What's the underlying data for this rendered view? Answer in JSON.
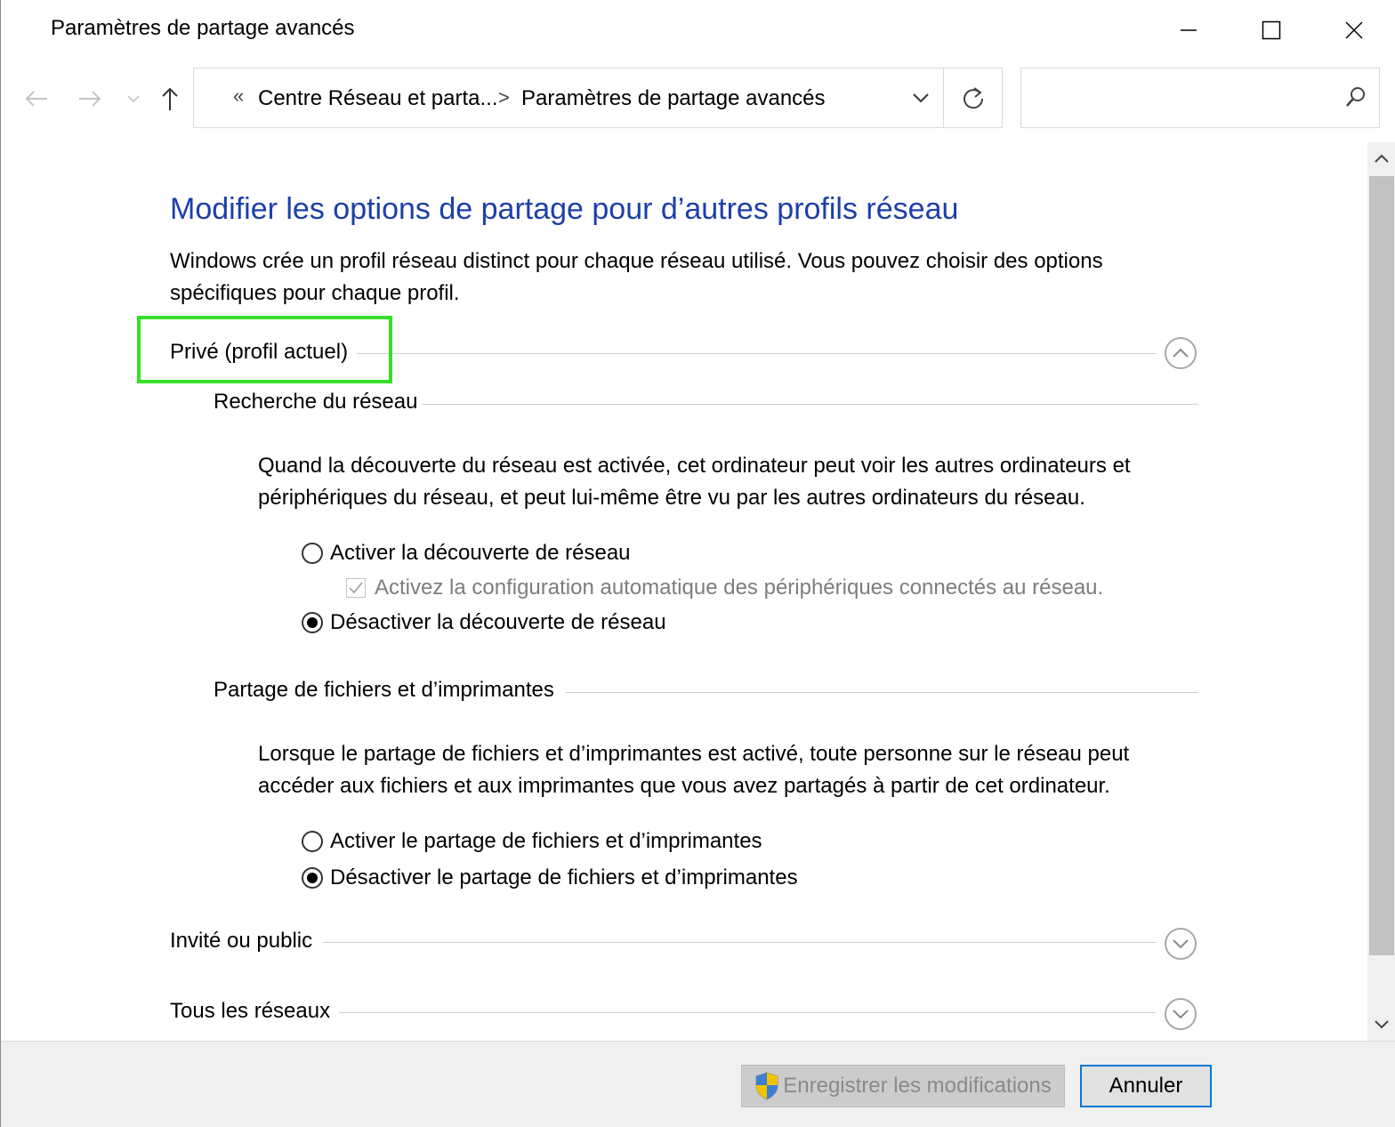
{
  "window": {
    "title": "Paramètres de partage avancés",
    "controls": {
      "minimize": "minimize-icon",
      "maximize": "maximize-icon",
      "close": "close-icon"
    }
  },
  "nav": {
    "back": "arrow-left-icon",
    "forward": "arrow-right-icon",
    "recent": "chevron-down-icon",
    "up": "arrow-up-icon",
    "breadcrumb": {
      "overflow": "«",
      "items": [
        "Centre Réseau et parta...",
        "Paramètres de partage avancés"
      ],
      "separator": ">"
    },
    "search_placeholder": ""
  },
  "main": {
    "title": "Modifier les options de partage pour d’autres profils réseau",
    "description": "Windows crée un profil réseau distinct pour chaque réseau utilisé. Vous pouvez choisir des options spécifiques pour chaque profil.",
    "profiles": [
      {
        "label": "Privé (profil actuel)",
        "expanded": true,
        "sections": [
          {
            "label": "Recherche du réseau",
            "description": "Quand la découverte du réseau est activée, cet ordinateur peut voir les autres ordinateurs et périphériques du réseau, et peut lui-même être vu par les autres ordinateurs du réseau.",
            "options": [
              {
                "label": "Activer la découverte de réseau",
                "selected": false
              },
              {
                "label": "Désactiver la découverte de réseau",
                "selected": true
              }
            ],
            "checkbox": {
              "label": "Activez la configuration automatique des périphériques connectés au réseau.",
              "checked": true,
              "enabled": false
            }
          },
          {
            "label": "Partage de fichiers et d’imprimantes",
            "description": "Lorsque le partage de fichiers et d’imprimantes est activé, toute personne sur le réseau peut accéder aux fichiers et aux imprimantes que vous avez partagés à partir de cet ordinateur.",
            "options": [
              {
                "label": "Activer le partage de fichiers et d’imprimantes",
                "selected": false
              },
              {
                "label": "Désactiver le partage de fichiers et d’imprimantes",
                "selected": true
              }
            ]
          }
        ]
      },
      {
        "label": "Invité ou public",
        "expanded": false
      },
      {
        "label": "Tous les réseaux",
        "expanded": false
      }
    ]
  },
  "footer": {
    "save_label": "Enregistrer les modifications",
    "cancel_label": "Annuler"
  },
  "colors": {
    "title_blue": "#1c3faa",
    "highlight_green": "#34e026",
    "focus_blue": "#0078d7"
  }
}
